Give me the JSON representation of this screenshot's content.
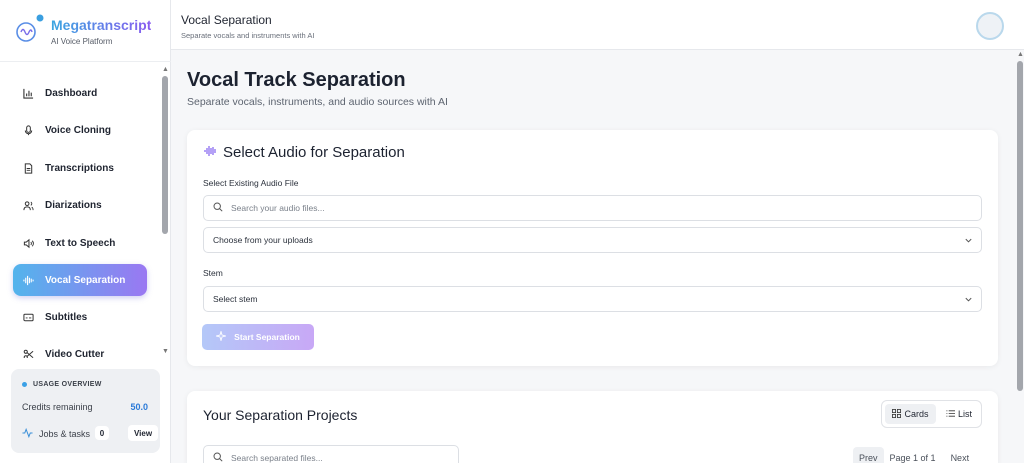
{
  "brand": {
    "name": "Megatranscript",
    "tagline": "AI Voice Platform"
  },
  "nav": {
    "items": [
      {
        "label": "Dashboard",
        "icon": "chart-icon"
      },
      {
        "label": "Voice Cloning",
        "icon": "mic-icon"
      },
      {
        "label": "Transcriptions",
        "icon": "document-icon"
      },
      {
        "label": "Diarizations",
        "icon": "users-icon"
      },
      {
        "label": "Text to Speech",
        "icon": "speaker-icon"
      },
      {
        "label": "Vocal Separation",
        "icon": "waveform-icon",
        "active": true
      },
      {
        "label": "Subtitles",
        "icon": "subtitles-icon"
      },
      {
        "label": "Video Cutter",
        "icon": "scissors-icon"
      }
    ]
  },
  "usage": {
    "heading": "USAGE OVERVIEW",
    "credits_label": "Credits remaining",
    "credits_value": "50.0",
    "jobs_label": "Jobs & tasks",
    "jobs_count": "0",
    "view_label": "View"
  },
  "header": {
    "title": "Vocal Separation",
    "subtitle": "Separate vocals and instruments with AI"
  },
  "page": {
    "title": "Vocal Track Separation",
    "subtitle": "Separate vocals, instruments, and audio sources with AI"
  },
  "select_card": {
    "title": "Select Audio for Separation",
    "file_label": "Select Existing Audio File",
    "search_placeholder": "Search your audio files...",
    "upload_select_value": "Choose from your uploads",
    "stem_label": "Stem",
    "stem_select_value": "Select stem",
    "start_button": "Start Separation"
  },
  "projects": {
    "title": "Your Separation Projects",
    "view_cards": "Cards",
    "view_list": "List",
    "search_placeholder": "Search separated files...",
    "prev": "Prev",
    "page_info": "Page 1 of 1",
    "next": "Next"
  },
  "colors": {
    "accent_start": "#53b4ec",
    "accent_end": "#9a78f2",
    "credits": "#2a7ad8"
  }
}
